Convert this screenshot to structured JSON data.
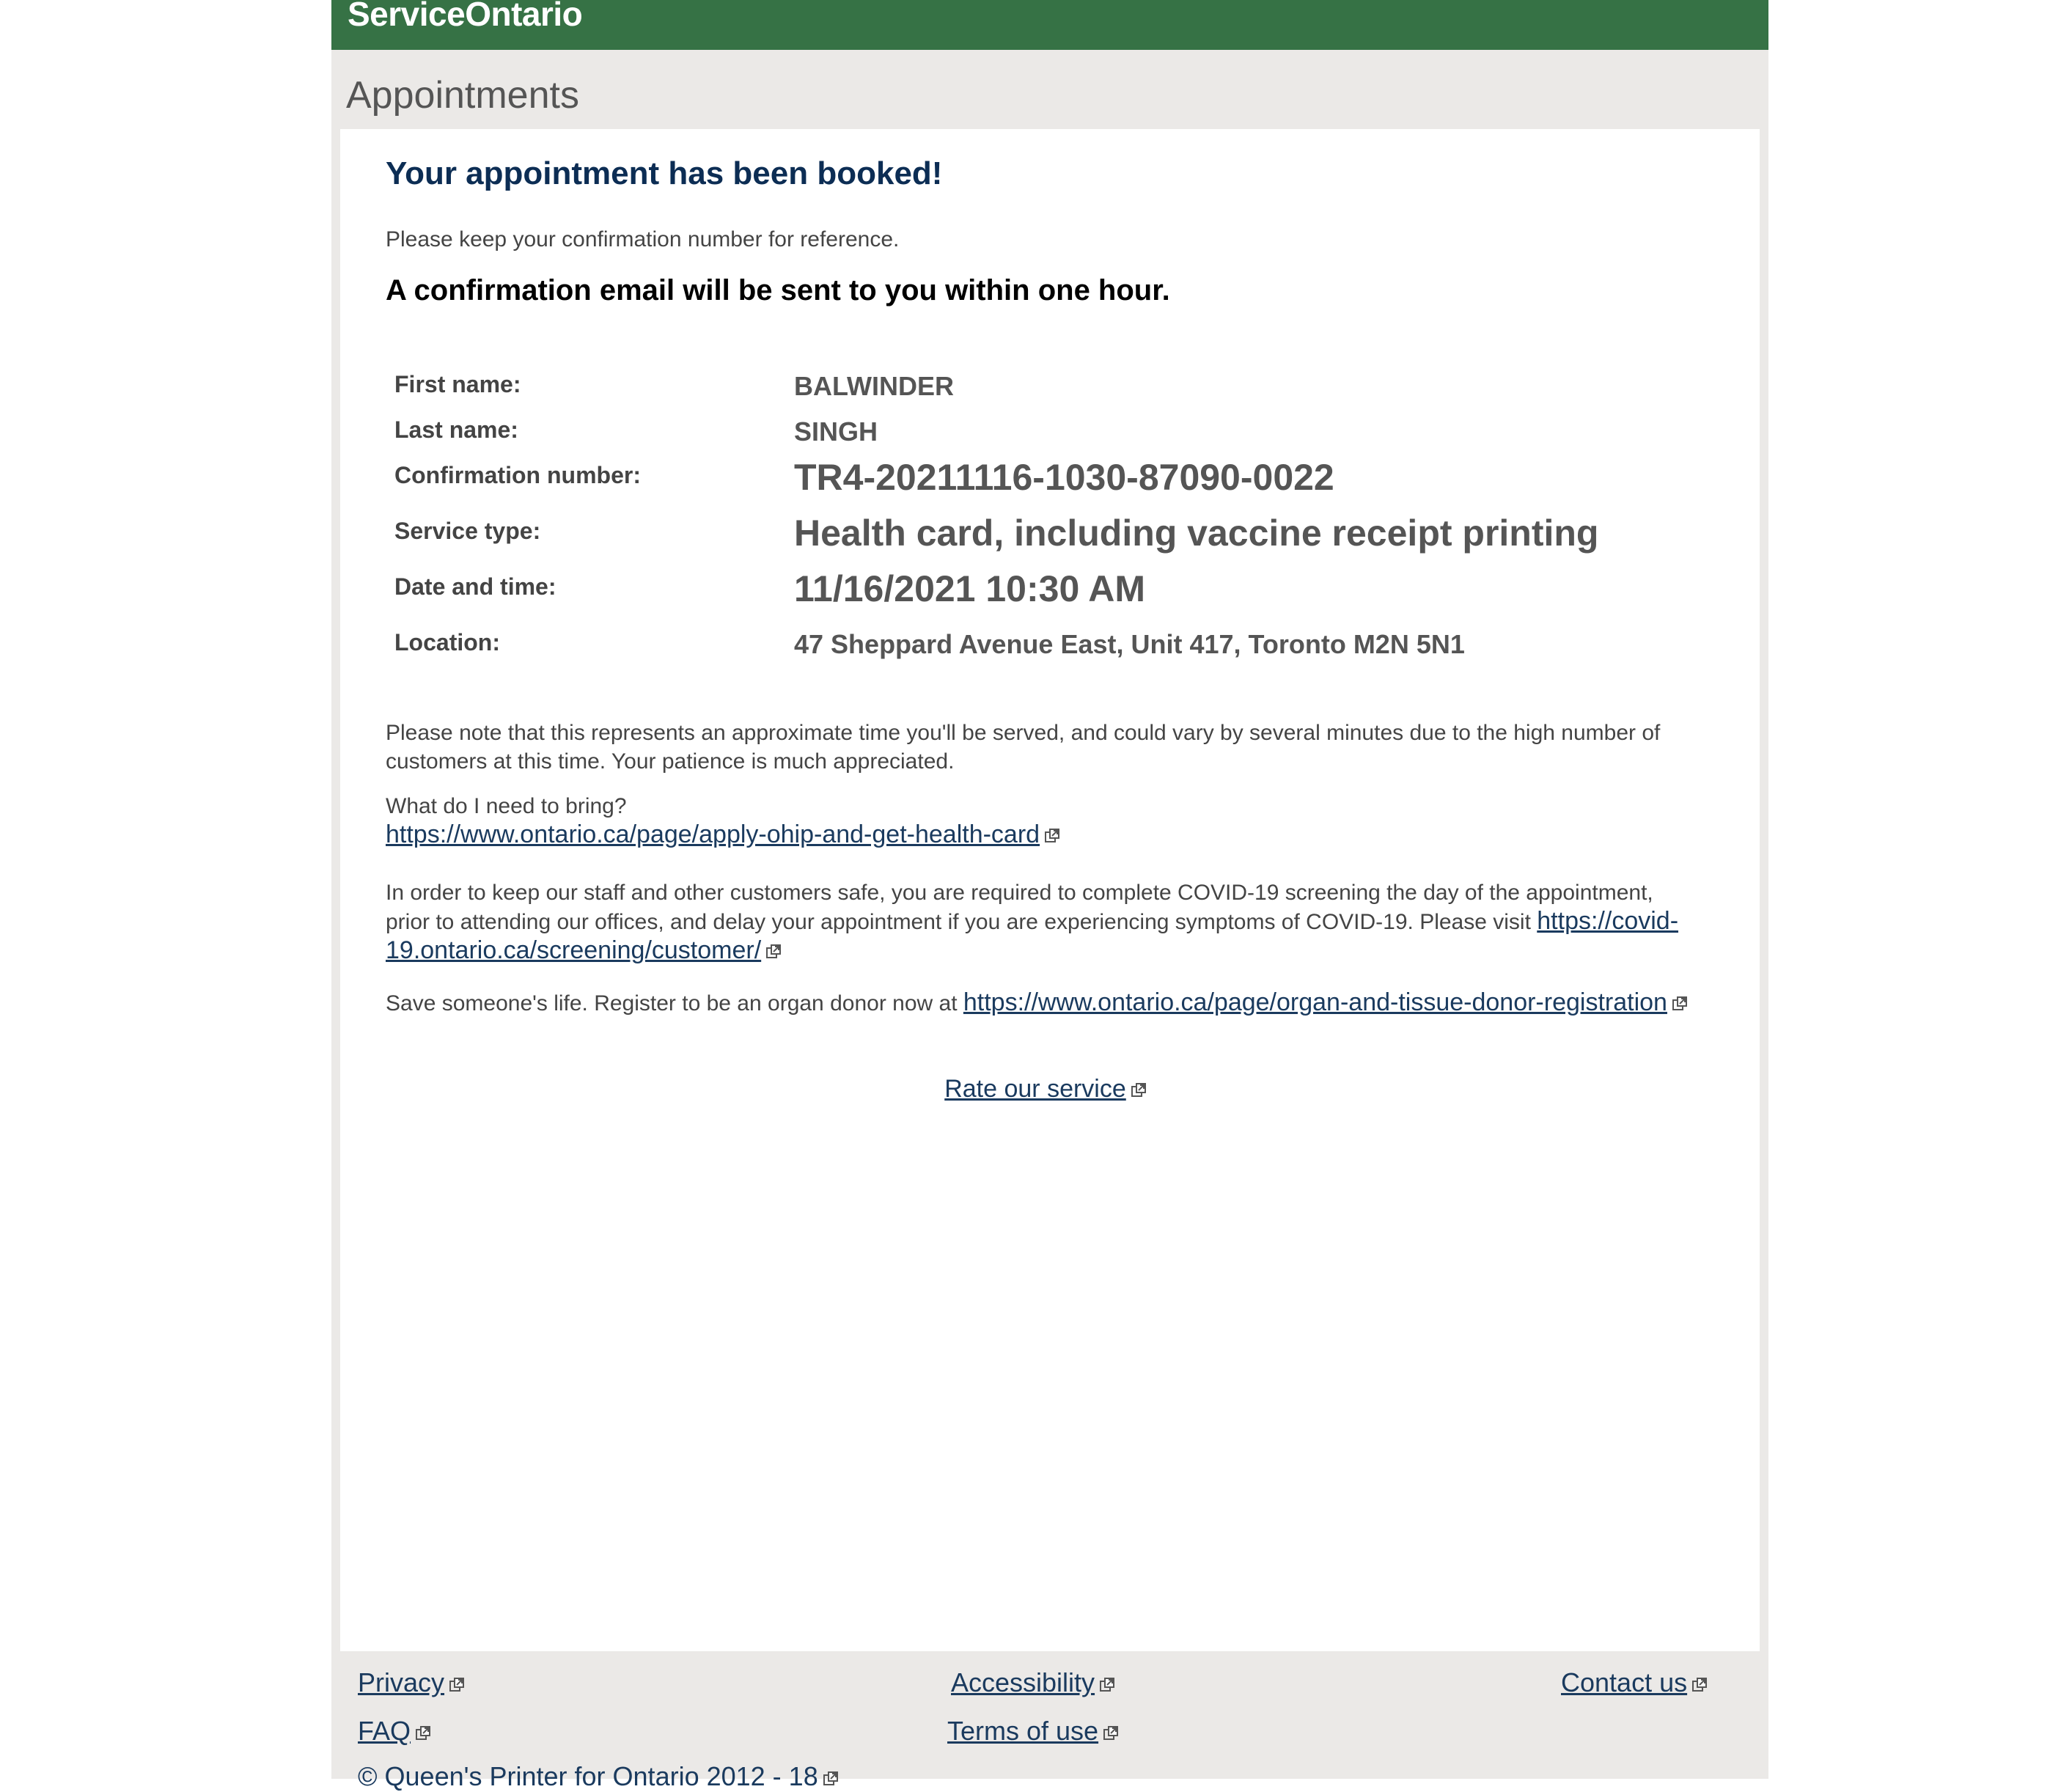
{
  "header": {
    "brand": "ServiceOntario"
  },
  "breadcrumb": "Appointments",
  "main": {
    "heading": "Your appointment has been booked!",
    "keep_note": "Please keep your confirmation number for reference.",
    "email_note": "A confirmation email will be sent to you within one hour.",
    "details": {
      "first_name_label": "First name:",
      "first_name": "BALWINDER",
      "last_name_label": "Last name:",
      "last_name": "SINGH",
      "confirmation_label": "Confirmation number:",
      "confirmation": "TR4-20211116-1030-87090-0022",
      "service_label": "Service type:",
      "service": "Health card, including vaccine receipt printing",
      "datetime_label": "Date and time:",
      "datetime": "11/16/2021 10:30 AM",
      "location_label": "Location:",
      "location": "47 Sheppard Avenue East, Unit 417, Toronto M2N 5N1"
    },
    "approx_note": "Please note that this represents an approximate time you'll be served, and could vary by several minutes due to the high number of customers at this time. Your patience is much appreciated.",
    "bring_question": "What do I need to bring?",
    "bring_link": "https://www.ontario.ca/page/apply-ohip-and-get-health-card",
    "covid_note": "In order to keep our staff and other customers safe, you are required to complete COVID-19 screening the day of the appointment, prior to attending our offices, and delay your appointment if you are experiencing symptoms of COVID-19. Please visit",
    "covid_link": "https://covid-19.ontario.ca/screening/customer/",
    "donor_note": "Save someone's life. Register to be an organ donor now at",
    "donor_link": "https://www.ontario.ca/page/organ-and-tissue-donor-registration",
    "rate_link": "Rate our service"
  },
  "footer": {
    "privacy": "Privacy",
    "accessibility": "Accessibility",
    "contact": "Contact us",
    "faq": "FAQ",
    "terms": "Terms of use",
    "copyright": "© Queen's Printer for Ontario 2012 - 18"
  }
}
